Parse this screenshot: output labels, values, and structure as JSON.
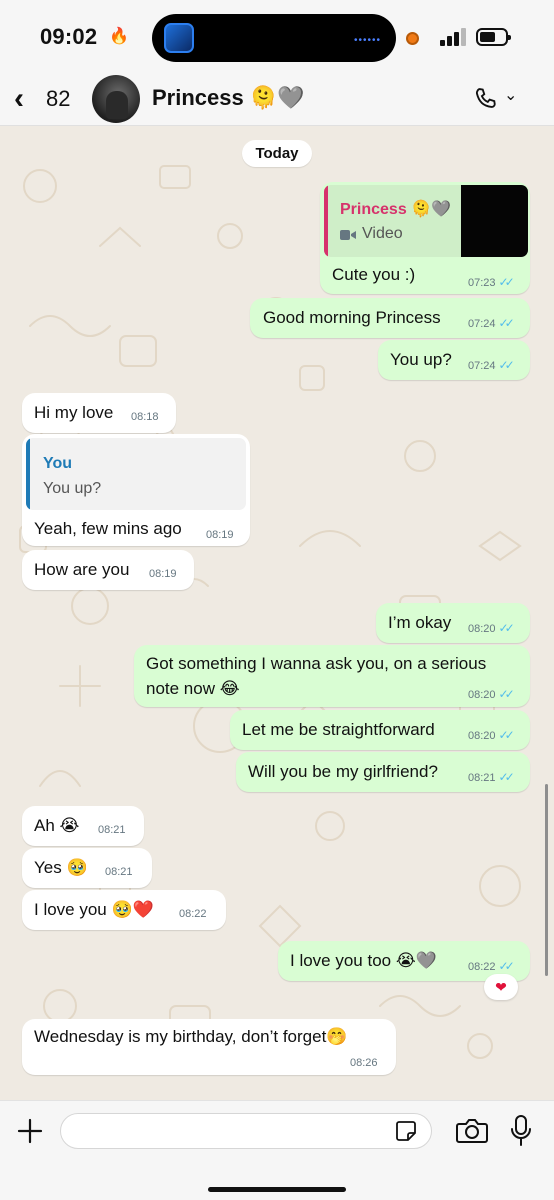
{
  "status": {
    "time": "09:02",
    "flame": "🔥"
  },
  "header": {
    "back_count": "82",
    "contact_name": "Princess 🫠🩶"
  },
  "day_divider": "Today",
  "messages": [
    {
      "dir": "out",
      "quote_author": "Princess 🫠🩶",
      "quote_kind": "Video",
      "text": "Cute you :)",
      "time": "07:23"
    },
    {
      "dir": "out",
      "text": "Good morning Princess",
      "time": "07:24"
    },
    {
      "dir": "out",
      "text": "You up?",
      "time": "07:24"
    },
    {
      "dir": "in",
      "text": "Hi my love",
      "time": "08:18"
    },
    {
      "dir": "in",
      "quote_author": "You",
      "quote_text": "You up?",
      "text": "Yeah, few mins ago",
      "time": "08:19"
    },
    {
      "dir": "in",
      "text": "How are you",
      "time": "08:19"
    },
    {
      "dir": "out",
      "text": "I’m okay",
      "time": "08:20"
    },
    {
      "dir": "out",
      "text_line1": "Got something I wanna ask you, on a serious",
      "text_line2": "note now 😂",
      "time": "08:20"
    },
    {
      "dir": "out",
      "text": "Let me be straightforward",
      "time": "08:20"
    },
    {
      "dir": "out",
      "text": "Will you be my girlfriend?",
      "time": "08:21"
    },
    {
      "dir": "in",
      "text": "Ah 😭",
      "time": "08:21"
    },
    {
      "dir": "in",
      "text": "Yes 🥹",
      "time": "08:21"
    },
    {
      "dir": "in",
      "text": "I love you 🥹❤️",
      "time": "08:22"
    },
    {
      "dir": "out",
      "text": "I love you too 😭🩶",
      "time": "08:22",
      "reaction": "❤"
    },
    {
      "dir": "in",
      "text": "Wednesday is my birthday, don’t forget🤭",
      "time": "08:26"
    }
  ],
  "composer": {
    "placeholder": ""
  },
  "colors": {
    "outgoing": "#d9fdd3",
    "incoming": "#ffffff",
    "read_ticks": "#53bdeb",
    "quote_princess": "#d6336c",
    "quote_you": "#1f7bb6"
  }
}
